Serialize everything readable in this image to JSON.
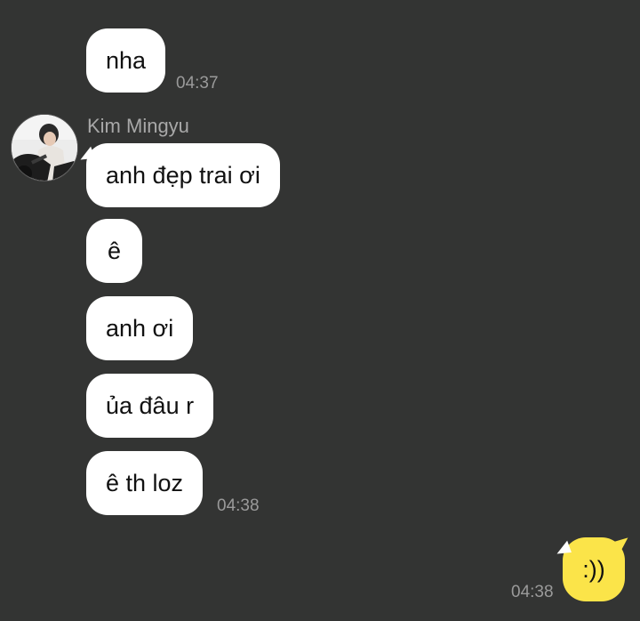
{
  "colors": {
    "background": "#333433",
    "incoming_bubble": "#ffffff",
    "outgoing_bubble": "#fbe449",
    "timestamp": "#9a9a9a",
    "sender_name": "#a8a8a8"
  },
  "messages": {
    "m0": {
      "text": "nha",
      "time": "04:37"
    },
    "sender": {
      "name": "Kim Mingyu",
      "avatar_icon": "user-avatar-photo"
    },
    "m1": {
      "text": "anh đẹp trai ơi"
    },
    "m2": {
      "text": "ê"
    },
    "m3": {
      "text": "anh ơi"
    },
    "m4": {
      "text": "ủa đâu r"
    },
    "m5": {
      "text": "ê th loz",
      "time": "04:38"
    },
    "me1": {
      "text": ":))",
      "time": "04:38"
    }
  }
}
